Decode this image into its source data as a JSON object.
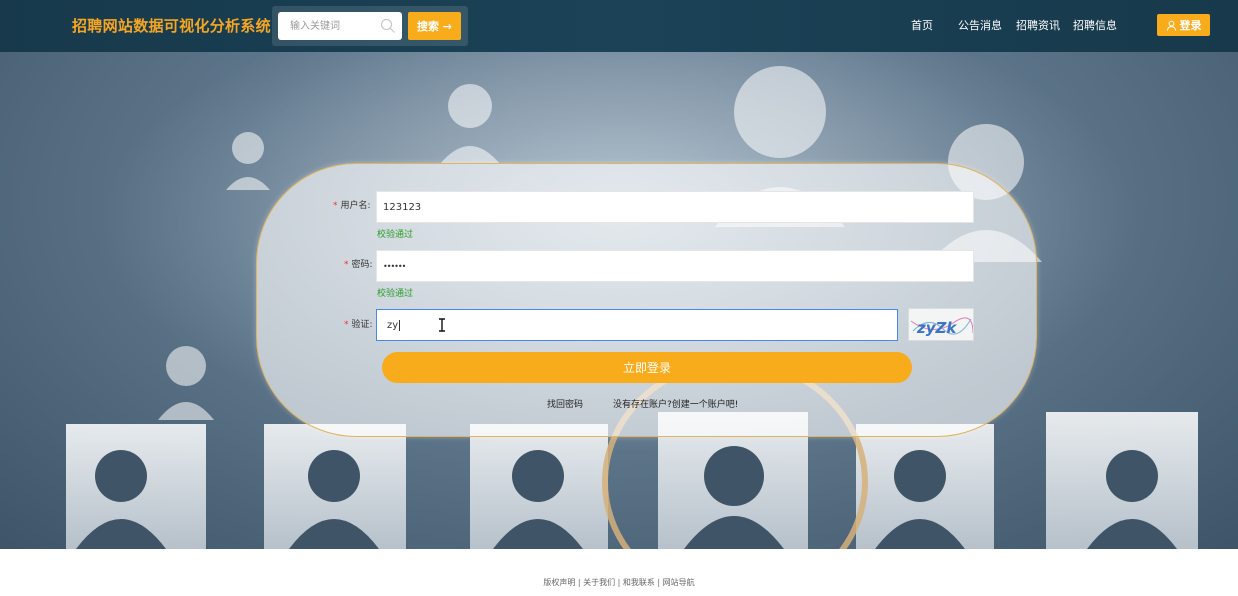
{
  "header": {
    "brand": "招聘网站数据可视化分析系统",
    "search_placeholder": "输入关键词",
    "search_button": "搜索 →",
    "nav": [
      "首页",
      "公告消息",
      "招聘资讯",
      "招聘信息"
    ],
    "login_button": "登录"
  },
  "login_form": {
    "username_label": "用户名:",
    "username_value": "123123",
    "username_hint": "校验通过",
    "password_label": "密码:",
    "password_value": "••••••",
    "password_hint": "校验通过",
    "captcha_label": "验证:",
    "captcha_value": "zy",
    "captcha_image_text": "zyZk",
    "submit_button": "立即登录",
    "forgot_link": "找回密码",
    "register_link": "没有存在账户?创建一个账户吧!"
  },
  "footer": {
    "text": "版权声明 | 关于我们 | 和我联系 | 网站导航"
  },
  "colors": {
    "accent": "#f8ab1b",
    "header_bg": "#17394b",
    "brand_text": "#f6a623",
    "hint_green": "#2a9d2a",
    "required_red": "#e33333"
  }
}
